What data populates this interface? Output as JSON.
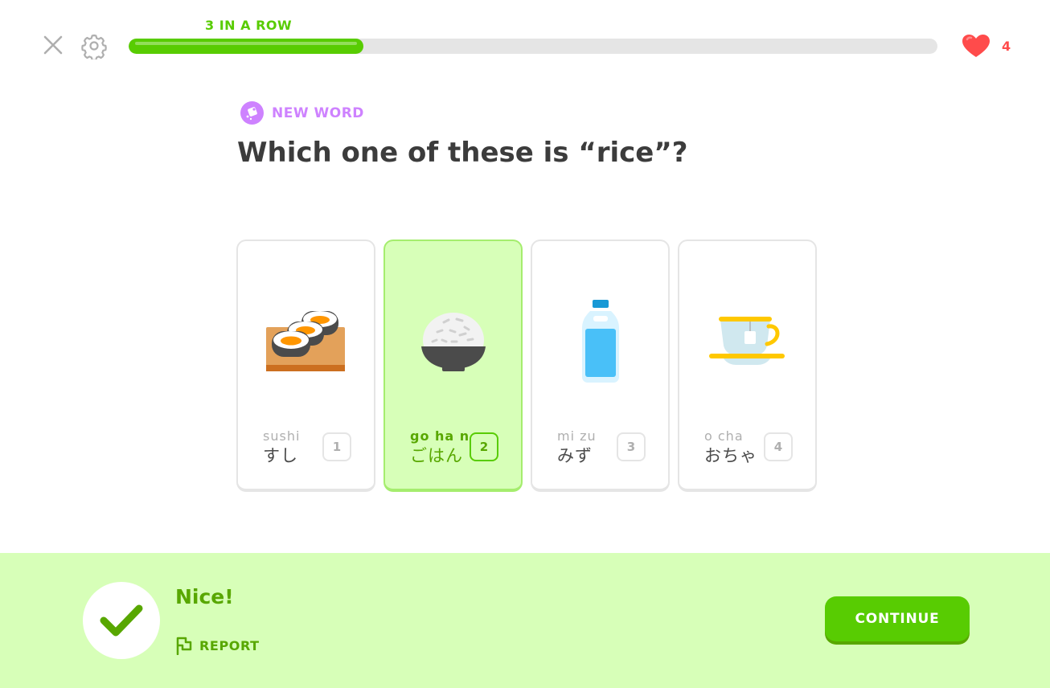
{
  "header": {
    "streak_label": "3 IN A ROW",
    "progress_fraction": 0.29,
    "hearts_count": "4",
    "icons": {
      "close": "close-icon",
      "settings": "gear-icon",
      "heart": "heart-icon"
    }
  },
  "challenge": {
    "badge_label": "NEW WORD",
    "prompt": "Which one of these is “rice”?"
  },
  "choices": [
    {
      "romaji": "sushi",
      "kana": "すし",
      "key": "1",
      "icon": "sushi-icon",
      "selected": false
    },
    {
      "romaji": "go ha n",
      "kana": "ごはん",
      "key": "2",
      "icon": "rice-bowl-icon",
      "selected": true
    },
    {
      "romaji": "mi zu",
      "kana": "みず",
      "key": "3",
      "icon": "water-bottle-icon",
      "selected": false
    },
    {
      "romaji": "o  cha",
      "kana": "おちゃ",
      "key": "4",
      "icon": "tea-cup-icon",
      "selected": false
    }
  ],
  "feedback": {
    "title": "Nice!",
    "report_label": "REPORT",
    "continue_label": "CONTINUE"
  },
  "colors": {
    "green": "#58cc02",
    "dark_green": "#58a700",
    "light_green": "#d7ffb8",
    "purple": "#ce82ff",
    "red": "#ff4b4b"
  }
}
